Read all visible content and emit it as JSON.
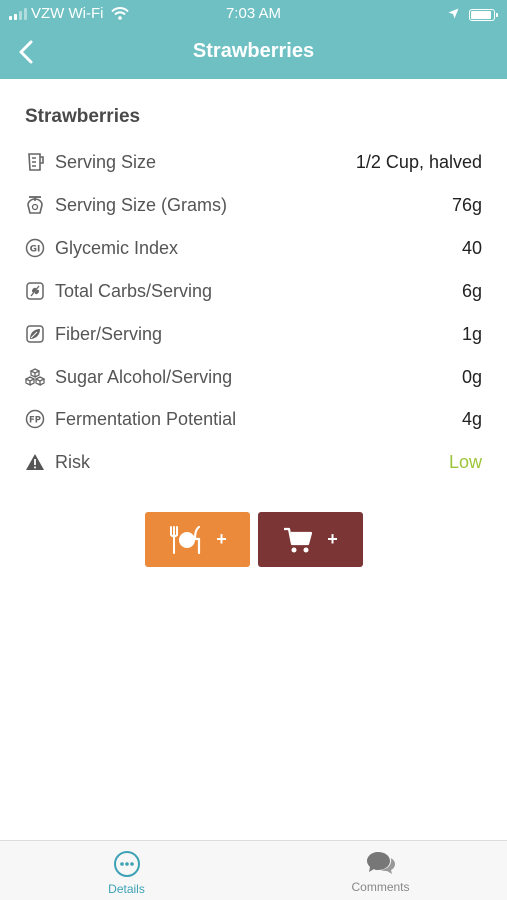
{
  "status_bar": {
    "carrier": "VZW Wi-Fi",
    "time": "7:03 AM"
  },
  "nav": {
    "title": "Strawberries"
  },
  "food": {
    "name": "Strawberries",
    "rows": [
      {
        "icon": "measuring-cup-icon",
        "label": "Serving Size",
        "value": "1/2 Cup, halved"
      },
      {
        "icon": "scale-icon",
        "label": "Serving Size (Grams)",
        "value": "76g"
      },
      {
        "icon": "gi-icon",
        "label": "Glycemic Index",
        "value": "40"
      },
      {
        "icon": "wheat-icon",
        "label": "Total Carbs/Serving",
        "value": "6g"
      },
      {
        "icon": "leaf-icon",
        "label": "Fiber/Serving",
        "value": "1g"
      },
      {
        "icon": "sugar-cubes-icon",
        "label": "Sugar Alcohol/Serving",
        "value": "0g"
      },
      {
        "icon": "fp-icon",
        "label": "Fermentation Potential",
        "value": "4g"
      },
      {
        "icon": "warning-icon",
        "label": "Risk",
        "value": "Low"
      }
    ]
  },
  "actions": {
    "add_meal_label": "+",
    "add_cart_label": "+"
  },
  "colors": {
    "header": "#6fc0c3",
    "meal_button": "#ea8a3a",
    "cart_button": "#7b3535",
    "risk_low": "#9dc53a",
    "tab_active": "#3da2b5"
  },
  "tabs": [
    {
      "label": "Details",
      "icon": "ellipsis-circle-icon",
      "active": true
    },
    {
      "label": "Comments",
      "icon": "chat-bubbles-icon",
      "active": false
    }
  ]
}
